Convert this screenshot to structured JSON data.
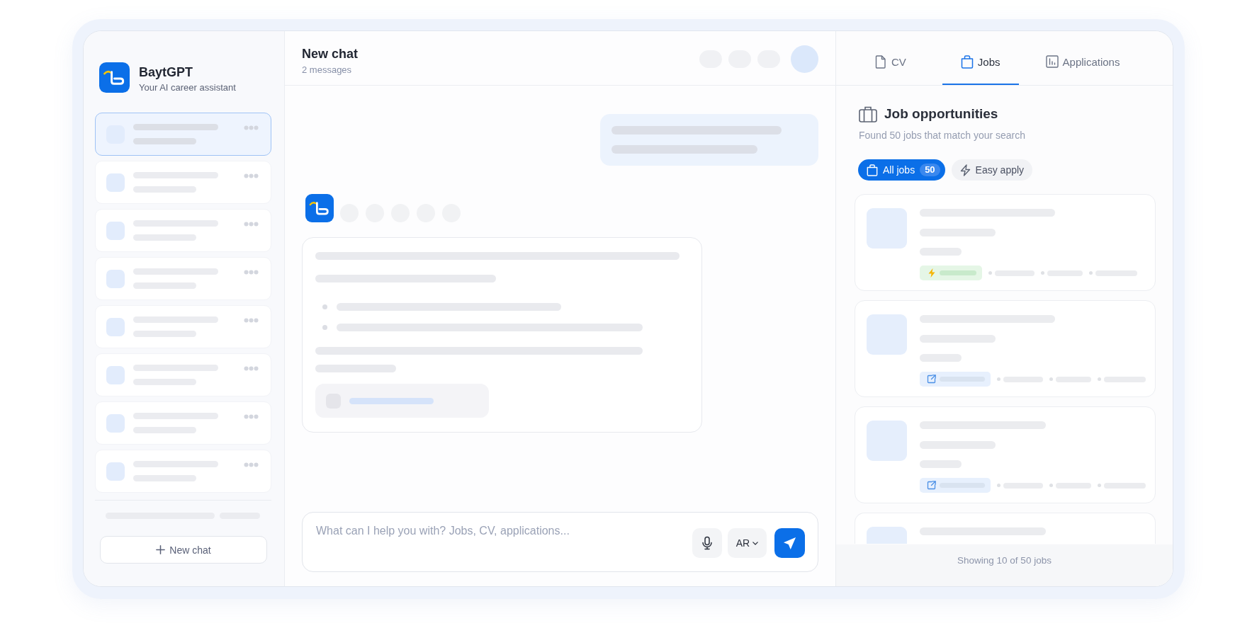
{
  "sidebar": {
    "app_name": "BaytGPT",
    "tagline": "Your AI career assistant",
    "conversations": [
      {
        "selected": true
      },
      {
        "selected": false
      },
      {
        "selected": false
      },
      {
        "selected": false
      },
      {
        "selected": false
      },
      {
        "selected": false
      },
      {
        "selected": false
      },
      {
        "selected": false
      }
    ],
    "new_chat_button": "New chat"
  },
  "chat": {
    "title": "New chat",
    "subtitle": "2 messages",
    "messages": [
      {
        "kind": "user"
      },
      {
        "kind": "assistant"
      }
    ],
    "composer": {
      "placeholder": "What can I help you with? Jobs, CV, applications...",
      "language_button": "AR"
    }
  },
  "side_panel": {
    "tabs": [
      {
        "label": "CV",
        "selected": false
      },
      {
        "label": "Jobs",
        "selected": true
      },
      {
        "label": "Applications",
        "selected": false
      }
    ],
    "title": "Job opportunities",
    "subtitle": "Found 50 jobs that match your search",
    "filters": [
      {
        "label": "All jobs",
        "count": "50",
        "selected": true
      },
      {
        "label": "Easy apply",
        "selected": false
      }
    ],
    "job_cards": [
      {
        "kind": "easy_apply"
      },
      {
        "kind": "external"
      },
      {
        "kind": "external"
      }
    ],
    "footer": "Showing 10 of 50 jobs"
  }
}
